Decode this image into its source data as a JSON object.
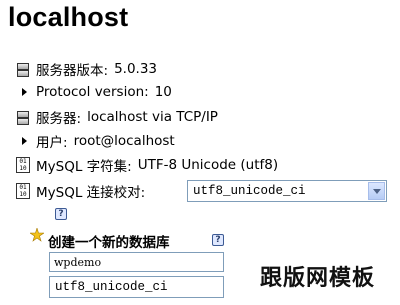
{
  "page": {
    "title": "localhost"
  },
  "server_info": {
    "server_version_label": "服务器版本:",
    "server_version_value": "5.0.33",
    "protocol_label": "Protocol version:",
    "protocol_value": "10",
    "server_label": "服务器:",
    "server_value": "localhost via TCP/IP",
    "user_label": "用户:",
    "user_value": "root@localhost",
    "charset_label": "MySQL 字符集:",
    "charset_value": "UTF-8 Unicode (utf8)",
    "collation_label": "MySQL 连接校对:",
    "collation_selected": "utf8_unicode_ci"
  },
  "create_db": {
    "title": "创建一个新的数据库",
    "name_value": "wpdemo",
    "collation_selected": "utf8_unicode_ci"
  },
  "icons": {
    "server": "server-icon",
    "arrow": "arrow-right-icon",
    "charset": "binary-icon",
    "help": "help-icon",
    "new_db": "new-database-icon"
  },
  "watermark": {
    "text": "跟版网模板"
  },
  "colors": {
    "select_border": "#7f9db9",
    "dropdown_button": "#b6ccf5",
    "help": "#3d5a94"
  }
}
